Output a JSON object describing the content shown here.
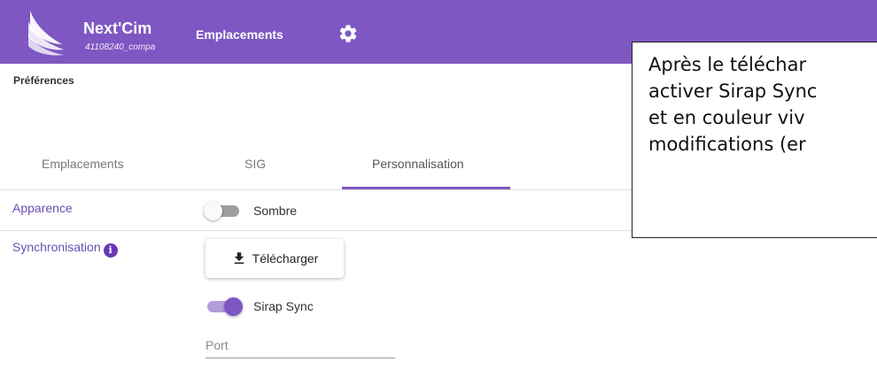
{
  "header": {
    "app_name": "Next'Cim",
    "app_subtitle": "41108240_compa",
    "nav_title": "Emplacements",
    "settings_icon": "gear-icon"
  },
  "page": {
    "section_title": "Préférences"
  },
  "tabs": [
    {
      "label": "Emplacements",
      "active": false
    },
    {
      "label": "SIG",
      "active": false
    },
    {
      "label": "Personnalisation",
      "active": true
    }
  ],
  "appearance": {
    "label": "Apparence",
    "toggle_label": "Sombre",
    "toggle_on": false
  },
  "sync": {
    "label": "Synchronisation",
    "info_icon": "info-icon",
    "download_label": "Télécharger",
    "download_icon": "download-icon",
    "sync_toggle_label": "Sirap Sync",
    "sync_toggle_on": true,
    "port_placeholder": "Port"
  },
  "callout": {
    "lines": [
      "Après le téléchar",
      "activer Sirap Sync",
      "et en couleur viv",
      "modifications (er"
    ]
  },
  "colors": {
    "brand": "#7e57c2",
    "link": "#6a4fb3"
  }
}
